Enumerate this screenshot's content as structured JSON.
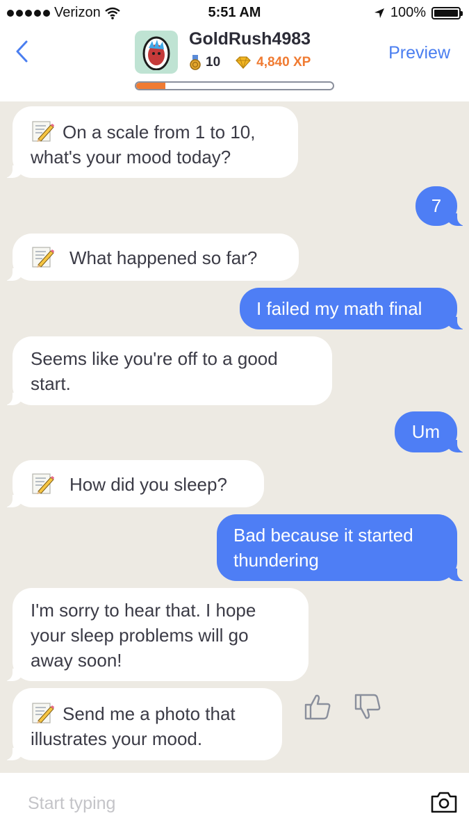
{
  "status_bar": {
    "carrier": "Verizon",
    "time": "5:51 AM",
    "battery": "100%"
  },
  "header": {
    "back_icon": "chevron-left-icon",
    "username": "GoldRush4983",
    "medal_count": "10",
    "xp": "4,840 XP",
    "level_progress": 0.15,
    "preview_label": "Preview"
  },
  "messages": [
    {
      "from": "bot",
      "icon": "memo-icon",
      "text": "On a scale from 1 to 10, what's your mood today?"
    },
    {
      "from": "user",
      "text": "7"
    },
    {
      "from": "bot",
      "icon": "memo-icon",
      "text": "What happened so far?"
    },
    {
      "from": "user",
      "text": "I failed my math final"
    },
    {
      "from": "bot",
      "text": "Seems like you're off to a good start."
    },
    {
      "from": "user",
      "text": "Um"
    },
    {
      "from": "bot",
      "icon": "memo-icon",
      "text": "How did you sleep?"
    },
    {
      "from": "user",
      "text": "Bad because it started thundering"
    },
    {
      "from": "bot",
      "text": "I'm sorry to hear that. I hope your sleep problems will go away soon!"
    },
    {
      "from": "bot",
      "icon": "memo-icon",
      "text": "Send me a photo that illustrates your mood."
    }
  ],
  "input": {
    "placeholder": "Start typing",
    "camera_icon": "camera-icon"
  },
  "colors": {
    "accent_blue": "#4e7ef5",
    "xp_orange": "#f07b32",
    "chat_background": "#edeae3"
  }
}
